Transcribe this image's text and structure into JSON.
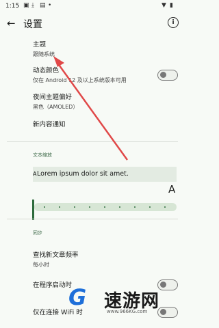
{
  "status": {
    "time": "1:15"
  },
  "appbar": {
    "title": "设置"
  },
  "settings": {
    "theme": {
      "title": "主题",
      "subtitle": "跟随系统"
    },
    "dynamic_color": {
      "title": "动态颜色",
      "subtitle": "仅在 Android 12 及以上系统版本可用",
      "enabled": false
    },
    "night_theme": {
      "title": "夜间主题偏好",
      "subtitle": "黑色（AMOLED）"
    },
    "new_content": {
      "title": "新内容通知"
    }
  },
  "text_scale": {
    "section_label": "文本缩放",
    "preview": "Lorem ipsum dolor sit amet.",
    "small_label": "A",
    "large_label": "A",
    "slider_value": 0
  },
  "sync": {
    "section_label": "同步",
    "frequency": {
      "title": "查找新文章频率",
      "subtitle": "每小时"
    },
    "on_start": {
      "title": "在程序启动时",
      "enabled": false
    },
    "wifi_only": {
      "title": "仅在连接 WiFi 时",
      "enabled": false
    }
  },
  "watermark": {
    "brand": "速游网",
    "url": "www.966KG.com"
  },
  "colors": {
    "accent": "#2e6b3c",
    "arrow": "#e04848",
    "background": "#f7faf6"
  }
}
